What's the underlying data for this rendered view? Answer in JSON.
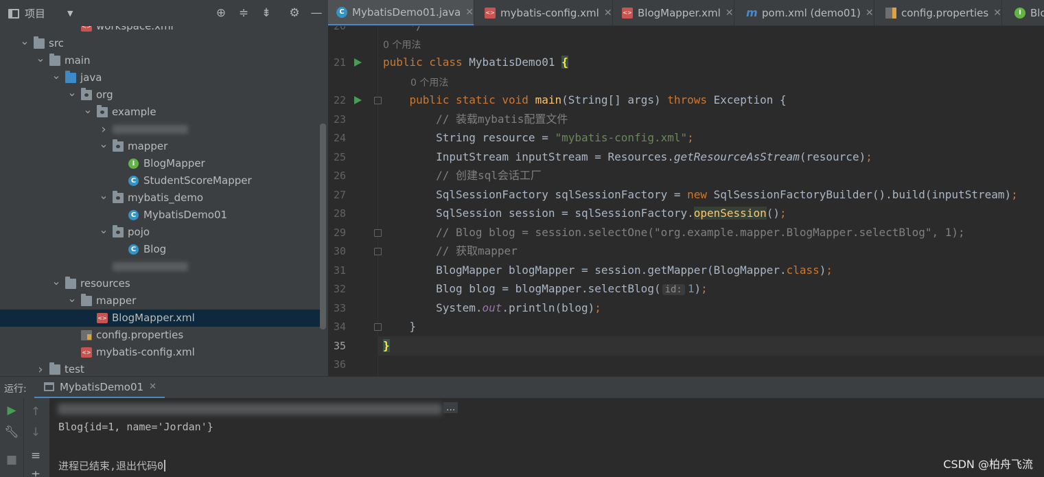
{
  "project_panel": {
    "title": "项目",
    "header_icons": [
      "target-icon",
      "expand-all-icon",
      "collapse-all-icon",
      "gear-icon",
      "minimize-icon"
    ],
    "tree": [
      {
        "label": "workspace.xml",
        "icon": "xml-file-icon",
        "indent": 4,
        "arrow": ""
      },
      {
        "label": "src",
        "icon": "folder-icon",
        "indent": 1,
        "arrow": "down"
      },
      {
        "label": "main",
        "icon": "folder-icon",
        "indent": 2,
        "arrow": "down"
      },
      {
        "label": "java",
        "icon": "source-folder-icon",
        "indent": 3,
        "arrow": "down"
      },
      {
        "label": "org",
        "icon": "package-icon",
        "indent": 4,
        "arrow": "down"
      },
      {
        "label": "example",
        "icon": "package-icon",
        "indent": 5,
        "arrow": "down"
      },
      {
        "label": "",
        "icon": "blurred",
        "indent": 6,
        "arrow": "right"
      },
      {
        "label": "mapper",
        "icon": "package-icon",
        "indent": 6,
        "arrow": "down"
      },
      {
        "label": "BlogMapper",
        "icon": "interface-icon",
        "indent": 7,
        "arrow": ""
      },
      {
        "label": "StudentScoreMapper",
        "icon": "class-icon",
        "indent": 7,
        "arrow": ""
      },
      {
        "label": "mybatis_demo",
        "icon": "package-icon",
        "indent": 6,
        "arrow": "down"
      },
      {
        "label": "MybatisDemo01",
        "icon": "runnable-class-icon",
        "indent": 7,
        "arrow": ""
      },
      {
        "label": "pojo",
        "icon": "package-icon",
        "indent": 6,
        "arrow": "down"
      },
      {
        "label": "Blog",
        "icon": "class-icon",
        "indent": 7,
        "arrow": ""
      },
      {
        "label": "",
        "icon": "blurred",
        "indent": 6,
        "arrow": ""
      },
      {
        "label": "resources",
        "icon": "resources-folder-icon",
        "indent": 3,
        "arrow": "down"
      },
      {
        "label": "mapper",
        "icon": "folder-icon",
        "indent": 4,
        "arrow": "down"
      },
      {
        "label": "BlogMapper.xml",
        "icon": "xml-file-icon",
        "indent": 5,
        "arrow": "",
        "selected": true
      },
      {
        "label": "config.properties",
        "icon": "properties-file-icon",
        "indent": 4,
        "arrow": ""
      },
      {
        "label": "mybatis-config.xml",
        "icon": "xml-file-icon",
        "indent": 4,
        "arrow": ""
      },
      {
        "label": "test",
        "icon": "folder-icon",
        "indent": 2,
        "arrow": "right"
      }
    ]
  },
  "tabs": [
    {
      "label": "MybatisDemo01.java",
      "icon": "runnable-class-icon",
      "active": true
    },
    {
      "label": "mybatis-config.xml",
      "icon": "xml-file-icon",
      "active": false
    },
    {
      "label": "BlogMapper.xml",
      "icon": "xml-file-icon",
      "active": false
    },
    {
      "label": "pom.xml (demo01)",
      "icon": "maven-icon",
      "active": false
    },
    {
      "label": "config.properties",
      "icon": "properties-file-icon",
      "active": false
    },
    {
      "label": "Blo",
      "icon": "interface-icon",
      "active": false
    }
  ],
  "editor": {
    "lines": [
      {
        "n": "20",
        "tokens": [
          [
            "cm",
            "    */"
          ]
        ]
      },
      {
        "n": "",
        "hint": "0 个用法"
      },
      {
        "n": "21",
        "run": true,
        "tokens": [
          [
            "kw",
            "public class "
          ],
          [
            "",
            "MybatisDemo01 "
          ],
          [
            "brace-hl",
            "{"
          ]
        ]
      },
      {
        "n": "",
        "hint": "0 个用法",
        "indent": 40
      },
      {
        "n": "22",
        "run": true,
        "fold": true,
        "tokens": [
          [
            "",
            "    "
          ],
          [
            "kw",
            "public static void "
          ],
          [
            "fn",
            "main"
          ],
          [
            "",
            "(String[] args) "
          ],
          [
            "kw",
            "throws "
          ],
          [
            "",
            "Exception {"
          ]
        ]
      },
      {
        "n": "23",
        "tokens": [
          [
            "",
            "        "
          ],
          [
            "cm",
            "// 装载mybatis配置文件"
          ]
        ]
      },
      {
        "n": "24",
        "tokens": [
          [
            "",
            "        String resource = "
          ],
          [
            "str",
            "\"mybatis-config.xml\""
          ],
          [
            "kw",
            ";"
          ]
        ]
      },
      {
        "n": "25",
        "tokens": [
          [
            "",
            "        InputStream inputStream = Resources."
          ],
          [
            "it",
            "getResourceAsStream"
          ],
          [
            "",
            "(resource)"
          ],
          [
            "kw",
            ";"
          ]
        ]
      },
      {
        "n": "26",
        "tokens": [
          [
            "",
            "        "
          ],
          [
            "cm",
            "// 创建sql会话工厂"
          ]
        ]
      },
      {
        "n": "27",
        "tokens": [
          [
            "",
            "        SqlSessionFactory sqlSessionFactory = "
          ],
          [
            "kw",
            "new "
          ],
          [
            "",
            "SqlSessionFactoryBuilder().build(inputStream)"
          ],
          [
            "kw",
            ";"
          ]
        ]
      },
      {
        "n": "28",
        "tokens": [
          [
            "",
            "        SqlSession session = sqlSessionFactory."
          ],
          [
            "hl-fn",
            "openSession"
          ],
          [
            "",
            "()"
          ],
          [
            "kw",
            ";"
          ]
        ]
      },
      {
        "n": "29",
        "fold": true,
        "tokens": [
          [
            "",
            "        "
          ],
          [
            "cm",
            "// Blog blog = session.selectOne(\"org.example.mapper.BlogMapper.selectBlog\", 1);"
          ]
        ]
      },
      {
        "n": "30",
        "fold": true,
        "tokens": [
          [
            "",
            "        "
          ],
          [
            "cm",
            "// 获取mapper"
          ]
        ]
      },
      {
        "n": "31",
        "tokens": [
          [
            "",
            "        BlogMapper blogMapper = session.getMapper(BlogMapper."
          ],
          [
            "kw",
            "class"
          ],
          [
            "",
            ")"
          ],
          [
            "kw",
            ";"
          ]
        ]
      },
      {
        "n": "32",
        "tokens": [
          [
            "",
            "        Blog blog = blogMapper.selectBlog("
          ],
          [
            "paramhint",
            "id:"
          ],
          [
            "num",
            "1"
          ],
          [
            "",
            ")"
          ],
          [
            "kw",
            ";"
          ]
        ]
      },
      {
        "n": "33",
        "tokens": [
          [
            "",
            "        System."
          ],
          [
            "stat",
            "out"
          ],
          [
            "",
            ".println(blog)"
          ],
          [
            "kw",
            ";"
          ]
        ]
      },
      {
        "n": "34",
        "fold": true,
        "tokens": [
          [
            "",
            "    }"
          ]
        ]
      },
      {
        "n": "35",
        "current": true,
        "tokens": [
          [
            "brace-hl",
            "}"
          ]
        ]
      },
      {
        "n": "36",
        "tokens": []
      }
    ]
  },
  "run_panel": {
    "label": "运行:",
    "tab": "MybatisDemo01",
    "ellipsis": "...",
    "output": [
      "Blog{id=1, name='Jordan'}",
      "",
      "进程已结束,退出代码0"
    ]
  },
  "watermark": "CSDN @柏舟飞流",
  "colors": {
    "accent": "#4a88c7",
    "run_green": "#499c54",
    "keyword": "#cc7832",
    "string": "#6a8759",
    "function": "#ffc66d",
    "comment": "#808080"
  }
}
